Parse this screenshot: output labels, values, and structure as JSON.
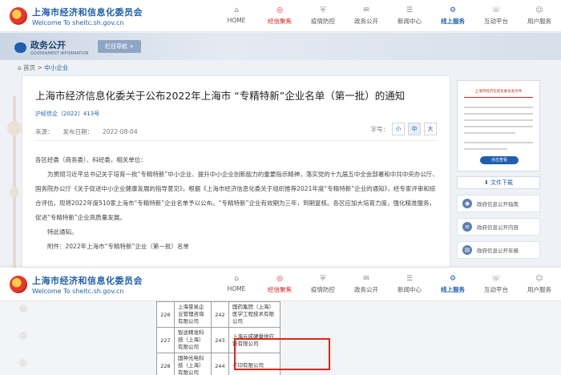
{
  "site": {
    "name_cn": "上海市经济和信息化委员会",
    "name_en": "Welcome To sheitc.sh.gov.cn"
  },
  "nav": [
    {
      "label": "HOME",
      "icon": "home-icon",
      "glyph": "⌂"
    },
    {
      "label": "经信聚焦",
      "icon": "focus-icon",
      "glyph": "◎"
    },
    {
      "label": "疫情防控",
      "icon": "shield-icon",
      "glyph": "⛨"
    },
    {
      "label": "政务公开",
      "icon": "chat-icon",
      "glyph": "✉"
    },
    {
      "label": "新闻中心",
      "icon": "news-icon",
      "glyph": "☰"
    },
    {
      "label": "线上服务",
      "icon": "service-icon",
      "glyph": "⚙"
    },
    {
      "label": "互动平台",
      "icon": "interact-icon",
      "glyph": "☏"
    },
    {
      "label": "用户服务",
      "icon": "user-icon",
      "glyph": "☺"
    }
  ],
  "banner": {
    "title_cn": "政务公开",
    "title_en": "GOVERNMENT INFORMATION",
    "nav_button": "栏目导航 +"
  },
  "breadcrumb": {
    "home": "首页",
    "sep": ">",
    "current": "中小企业"
  },
  "article": {
    "title": "上海市经济信息化委关于公布2022年上海市 “专精特新”企业名单（第一批）的通知",
    "doc_no": "沪经信企〔2022〕413号",
    "source_label": "来源：",
    "date_label": "发布日期：",
    "date": "2022-08-04",
    "fontsize_label": "字号：",
    "fontsize_small": "小",
    "fontsize_mid": "中",
    "fontsize_large": "大",
    "salutation": "各区经委（商务委）、科经委，相关单位：",
    "para1": "为贯彻习近平总书记关于培育一批“专精特新”中小企业、提升中小企业创新能力的重要指示精神，落实党的十九届五中全会部署和中共中央办公厅、国务院办公厅《关于促进中小企业健康发展的指导意见》，根据《上海市经济信息化委关于组织推荐2021年度“专精特新”企业的通知》，经专家评审和综合评估，现将2022年度510家上海市“专精特新”企业名单予以公布。“专精特新”企业有效期为三年，到期复核。各区应加大培育力度，强化精准服务，促进“专精特新”企业高质量发展。",
    "closing": "特此通知。",
    "attachment": "附件：2022年上海市“专精特新”企业（第一批）名单"
  },
  "sidebar": {
    "doc_title": "上海市经济信息化委员会文件",
    "view_button": "点击查看",
    "download": "文件下载",
    "links": [
      {
        "label": "政府信息公开指南",
        "icon": "compass-icon"
      },
      {
        "label": "政府信息公开内容",
        "icon": "list-icon"
      },
      {
        "label": "政府信息公开年报",
        "icon": "report-icon"
      }
    ]
  },
  "table": {
    "rows": [
      {
        "n1": "226",
        "c1": "上海誉易企业管理咨询有限公司",
        "n2": "242",
        "c2": "国药集团（上海）医学工程技术有限公司"
      },
      {
        "n1": "227",
        "c1": "智途精准科技（上海）有限公司",
        "n2": "243",
        "c2": "上海云成硬量供应链有限公司"
      },
      {
        "n1": "228",
        "c1": "国神光电科技（上海）有限公司",
        "n2": "244",
        "c2": "孑印有限公司"
      }
    ]
  }
}
